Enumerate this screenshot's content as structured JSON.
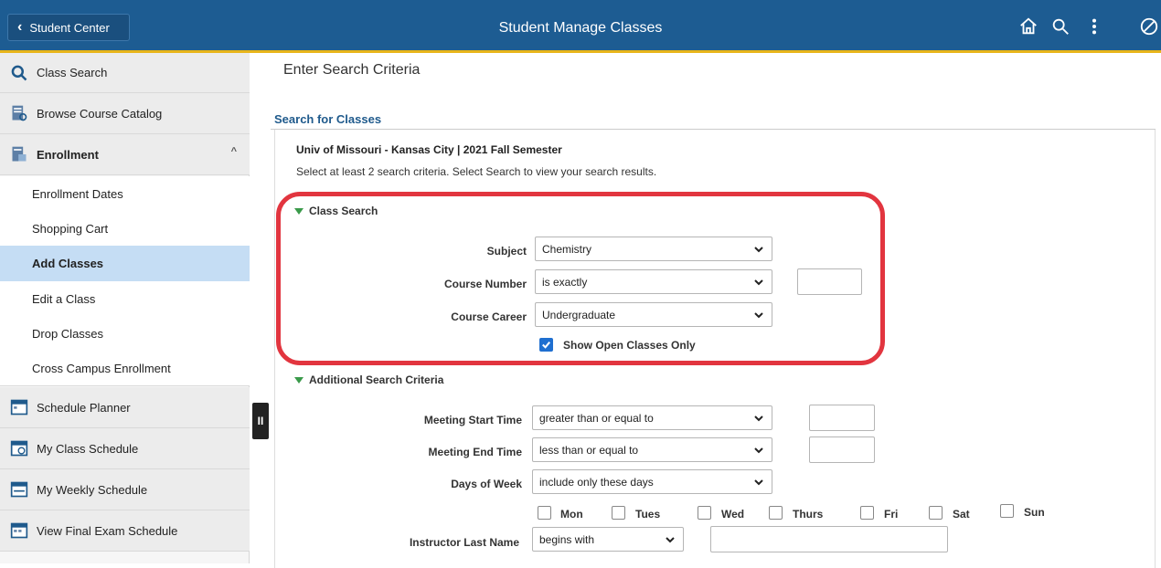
{
  "header": {
    "back_label": "Student Center",
    "title": "Student Manage Classes",
    "icons": [
      "home-icon",
      "search-icon",
      "more-vertical-icon",
      "disabled-circle-icon"
    ],
    "colors": {
      "bar": "#1d5c92",
      "accent": "#e8b51a"
    }
  },
  "sidebar": {
    "items": [
      {
        "label": "Class Search",
        "icon": "magnifier-icon"
      },
      {
        "label": "Browse Course Catalog",
        "icon": "catalog-icon"
      },
      {
        "label": "Enrollment",
        "icon": "enrollment-icon",
        "expanded": true
      },
      {
        "label": "Enrollment Dates"
      },
      {
        "label": "Shopping Cart"
      },
      {
        "label": "Add Classes",
        "active": true
      },
      {
        "label": "Edit a Class"
      },
      {
        "label": "Drop Classes"
      },
      {
        "label": "Cross Campus Enrollment"
      },
      {
        "label": "Schedule Planner",
        "icon": "planner-icon"
      },
      {
        "label": "My Class Schedule",
        "icon": "calendar-clock-icon"
      },
      {
        "label": "My Weekly Schedule",
        "icon": "weekly-calendar-icon"
      },
      {
        "label": "View Final Exam Schedule",
        "icon": "exam-schedule-icon"
      }
    ],
    "collapse_label": "II"
  },
  "main": {
    "page_title": "Enter Search Criteria",
    "section_title": "Search for Classes",
    "institution": "Univ of Missouri - Kansas City | 2021 Fall Semester",
    "instruction": "Select at least 2 search criteria. Select Search to view your search results.",
    "class_search": {
      "header": "Class Search",
      "subject_label": "Subject",
      "subject_value": "Chemistry",
      "course_number_label": "Course Number",
      "course_number_value": "is exactly",
      "course_career_label": "Course Career",
      "course_career_value": "Undergraduate",
      "open_only_label": "Show Open Classes Only",
      "open_only_checked": true
    },
    "additional": {
      "header": "Additional Search Criteria",
      "start_label": "Meeting Start Time",
      "start_value": "greater than or equal to",
      "end_label": "Meeting End Time",
      "end_value": "less than or equal to",
      "days_label": "Days of Week",
      "days_value": "include only these days",
      "days": [
        "Mon",
        "Tues",
        "Wed",
        "Thurs",
        "Fri",
        "Sat",
        "Sun"
      ],
      "instructor_label": "Instructor Last Name",
      "instructor_value": "begins with"
    },
    "highlight_color": "#e2353f"
  }
}
